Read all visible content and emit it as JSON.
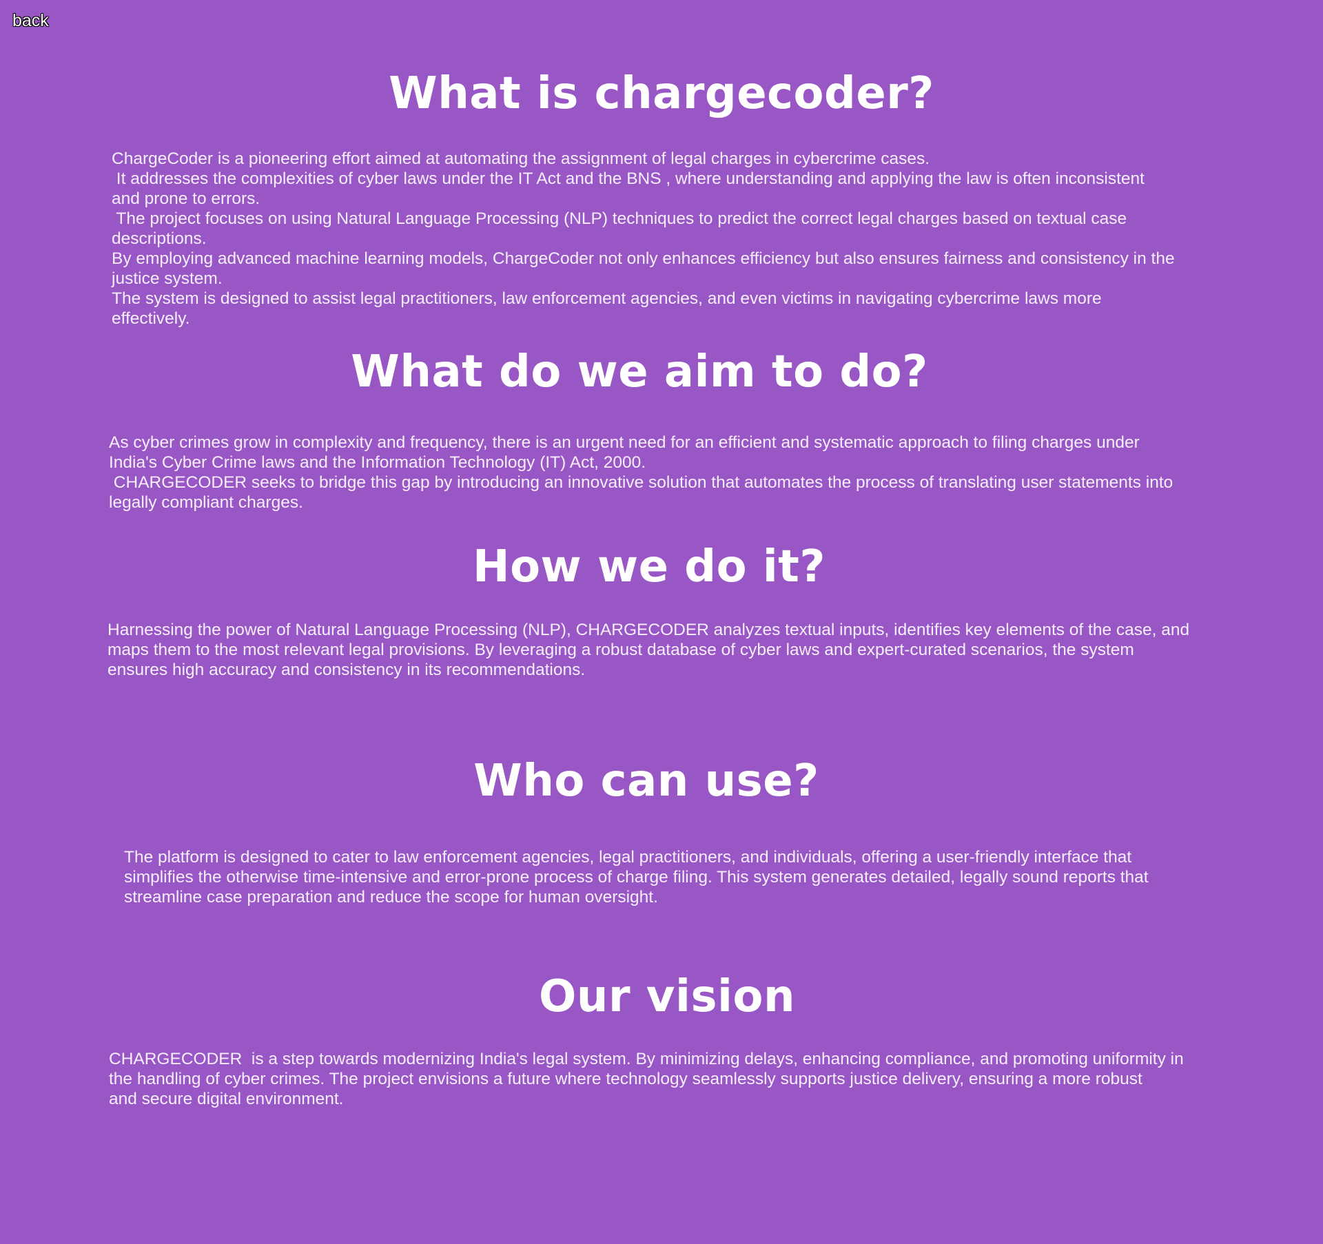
{
  "nav": {
    "back_label": "back"
  },
  "sections": [
    {
      "heading": "What is chargecoder?",
      "lines": [
        "ChargeCoder is a pioneering effort aimed at automating the assignment of legal charges in cybercrime cases.",
        " It addresses the complexities of cyber laws under the IT Act and the BNS , where understanding and applying the law is often inconsistent",
        "and prone to errors.",
        " The project focuses on using Natural Language Processing (NLP) techniques to predict the correct legal charges based on textual case",
        "descriptions.",
        "By employing advanced machine learning models, ChargeCoder not only enhances efficiency but also ensures fairness and consistency in the",
        "justice system.",
        "The system is designed to assist legal practitioners, law enforcement agencies, and even victims in navigating cybercrime laws more",
        "effectively."
      ]
    },
    {
      "heading": "What do we aim to do?",
      "lines": [
        "As cyber crimes grow in complexity and frequency, there is an urgent need for an efficient and systematic approach to filing charges under",
        "India's Cyber Crime laws and the Information Technology (IT) Act, 2000.",
        " CHARGECODER seeks to bridge this gap by introducing an innovative solution that automates the process of translating user statements into",
        "legally compliant charges."
      ]
    },
    {
      "heading": "How we do it?",
      "lines": [
        "Harnessing the power of Natural Language Processing (NLP), CHARGECODER analyzes textual inputs, identifies key elements of the case, and",
        "maps them to the most relevant legal provisions. By leveraging a robust database of cyber laws and expert-curated scenarios, the system",
        "ensures high accuracy and consistency in its recommendations."
      ]
    },
    {
      "heading": "Who can use?",
      "lines": [
        "The platform is designed to cater to law enforcement agencies, legal practitioners, and individuals, offering a user-friendly interface that",
        "simplifies the otherwise time-intensive and error-prone process of charge filing. This system generates detailed, legally sound reports that",
        "streamline case preparation and reduce the scope for human oversight."
      ]
    },
    {
      "heading": "Our vision",
      "lines": [
        "CHARGECODER  is a step towards modernizing India's legal system. By minimizing delays, enhancing compliance, and promoting uniformity in",
        "the handling of cyber crimes. The project envisions a future where technology seamlessly supports justice delivery, ensuring a more robust",
        "and secure digital environment."
      ]
    }
  ]
}
